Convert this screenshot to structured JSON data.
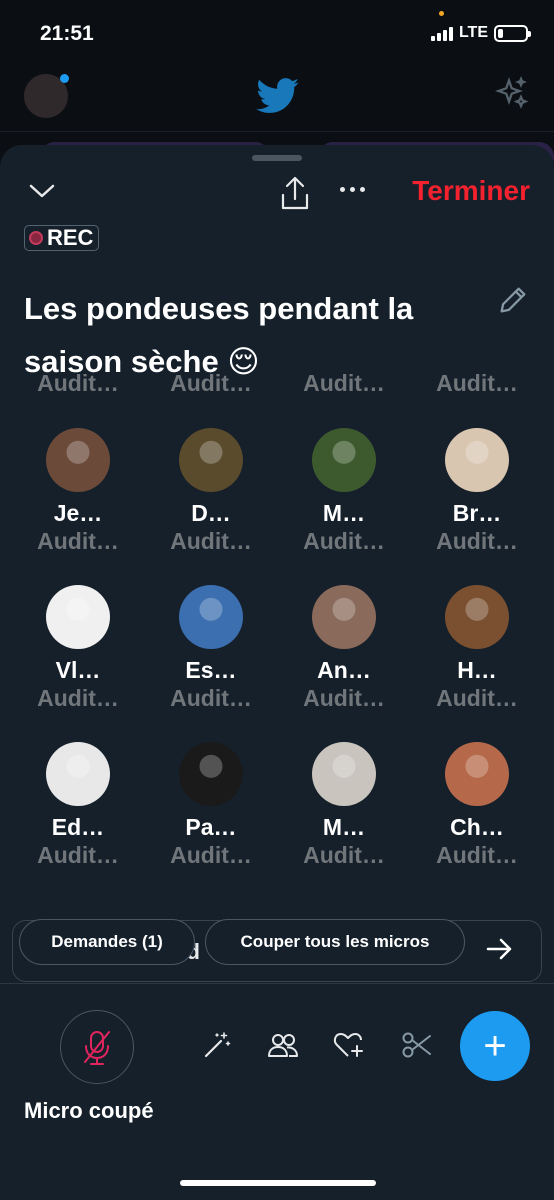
{
  "status_bar": {
    "time": "21:51",
    "network": "LTE"
  },
  "background": {
    "logo": "twitter-bird-icon",
    "action_icon": "sparkle-icon"
  },
  "header": {
    "end_label": "Terminer",
    "rec_label": "REC"
  },
  "space": {
    "title": "Les pondeuses pendant la saison sèche 😌"
  },
  "listeners_top_roles": [
    "Audit…",
    "Audit…",
    "Audit…",
    "Audit…"
  ],
  "listeners": [
    {
      "name": "Je…",
      "role": "Audit…",
      "avatar": "#6b4a3a"
    },
    {
      "name": "D…",
      "role": "Audit…",
      "avatar": "#5a4b2c"
    },
    {
      "name": "M…",
      "role": "Audit…",
      "avatar": "#3d5a2e"
    },
    {
      "name": "Br…",
      "role": "Audit…",
      "avatar": "#d9c6b0"
    },
    {
      "name": "Vl…",
      "role": "Audit…",
      "avatar": "#f0f0f0"
    },
    {
      "name": "Es…",
      "role": "Audit…",
      "avatar": "#3b6fb0"
    },
    {
      "name": "An…",
      "role": "Audit…",
      "avatar": "#8a6a5a"
    },
    {
      "name": "H…",
      "role": "Audit…",
      "avatar": "#7a5030"
    },
    {
      "name": "Ed…",
      "role": "Audit…",
      "avatar": "#e8e8e8"
    },
    {
      "name": "Pa…",
      "role": "Audit…",
      "avatar": "#1a1a1a"
    },
    {
      "name": "M…",
      "role": "Audit…",
      "avatar": "#c9c4bd"
    },
    {
      "name": "Ch…",
      "role": "Audit…",
      "avatar": "#b5694a"
    }
  ],
  "pills": {
    "requests_label": "Demandes (1)",
    "mute_all_label": "Couper tous les micros",
    "hidden_text": "ud"
  },
  "footer": {
    "mic_label": "Micro coupé",
    "fab_label": "+"
  },
  "colors": {
    "accent": "#1d9bf0",
    "danger": "#f4212e",
    "sheet": "#15202b"
  }
}
